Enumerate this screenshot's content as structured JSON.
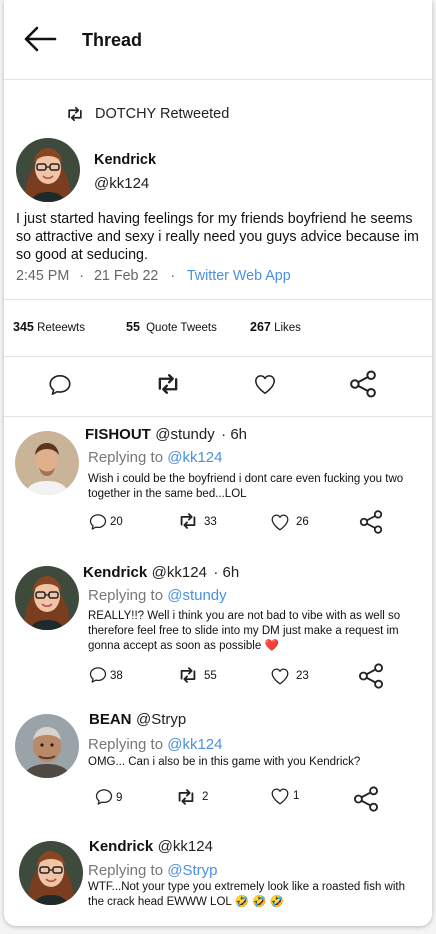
{
  "header": {
    "title": "Thread"
  },
  "retweet_banner": {
    "text": "DOTCHY Retweeted"
  },
  "main_tweet": {
    "name": "Kendrick",
    "handle": "@kk124",
    "text": "I just started having feelings for my friends boyfriend he seems so attractive and sexy i really need you guys advice because im so good at seducing.",
    "time": "2:45 PM",
    "dot1": "·",
    "date": "21 Feb 22",
    "dot2": "·",
    "source": "Twitter Web App"
  },
  "stats": {
    "retweets_count": "345",
    "retweets_label": "Reteewts",
    "quotes_count": "55",
    "quotes_label": "Quote Tweets",
    "likes_count": "267",
    "likes_label": "Likes"
  },
  "replies": [
    {
      "name": "FISHOUT",
      "handle": "@stundy",
      "time": "· 6h",
      "replying_label": "Replying to",
      "replying_to": "@kk124",
      "text": "Wish i could be the boyfriend i dont care even fucking you two together in the same bed...LOL",
      "comments": "20",
      "retweets": "33",
      "likes": "26"
    },
    {
      "name": "Kendrick",
      "handle": "@kk124",
      "time": "· 6h",
      "replying_label": "Replying to",
      "replying_to": "@stundy",
      "text": "REALLY!!? Well i think you are not bad to vibe with as well so therefore feel free to slide into my DM just make a request im gonna accept as soon as possible ❤️",
      "comments": "38",
      "retweets": "55",
      "likes": "23"
    },
    {
      "name": "BEAN",
      "handle": "@Stryp",
      "replying_label": "Replying to",
      "replying_to": "@kk124",
      "text": "OMG... Can i also be in this game with you Kendrick?",
      "comments": "9",
      "retweets": "2",
      "likes": "1"
    },
    {
      "name": "Kendrick",
      "handle": "@kk124",
      "replying_label": "Replying to",
      "replying_to": "@Stryp",
      "text": "WTF...Not your type you extremely look like a roasted fish with the crack head EWWW LOL 🤣 🤣 🤣"
    }
  ],
  "icons": {
    "back": "arrow-left-icon",
    "retweet": "retweet-icon",
    "comment": "comment-icon",
    "like": "heart-icon",
    "share": "share-icon"
  },
  "colors": {
    "link": "#4a90e2"
  }
}
